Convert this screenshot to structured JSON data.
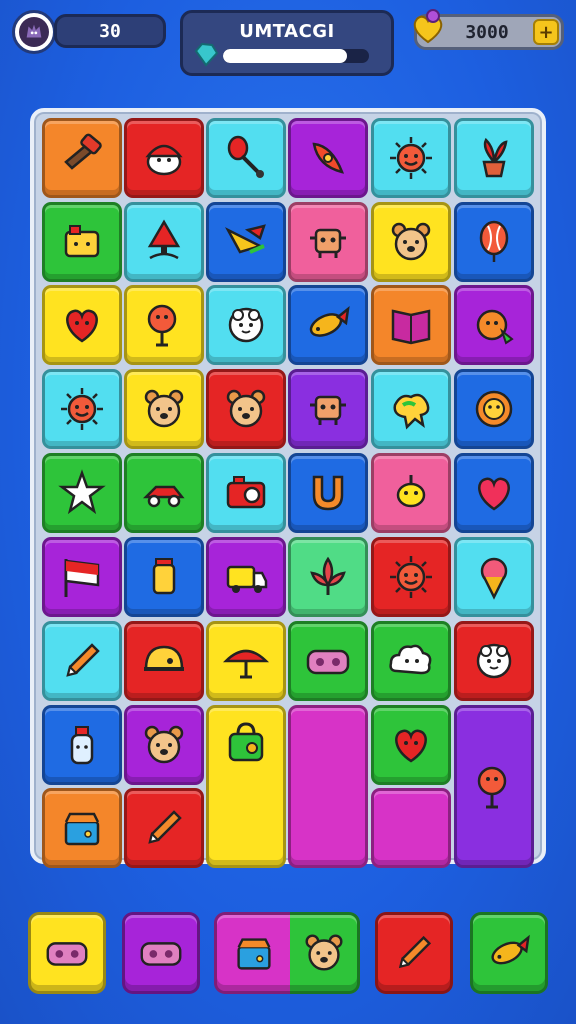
{
  "hud": {
    "moves": "30",
    "level_title": "UMTACGI",
    "level_progress_fraction": 0.85,
    "coins": "3000",
    "coins_plus": "+"
  },
  "colors": {
    "background": "#1d5fe0",
    "orange": "#f4862a",
    "red": "#e52525",
    "cyan": "#52def0",
    "purple": "#a724d9",
    "blue": "#1f6be3",
    "green": "#2ec43a",
    "yellow": "#ffe320",
    "pink": "#f0609c",
    "magenta": "#d733c7",
    "violet": "#8a2fe0",
    "mint": "#50dc86"
  },
  "board": {
    "tiles": [
      {
        "color": "orange",
        "icon": "hammer-icon"
      },
      {
        "color": "red",
        "icon": "santa-icon"
      },
      {
        "color": "cyan",
        "icon": "whisk-icon"
      },
      {
        "color": "purple",
        "icon": "rocket-icon"
      },
      {
        "color": "cyan",
        "icon": "sun-face-icon"
      },
      {
        "color": "cyan",
        "icon": "flower-pot-icon"
      },
      {
        "color": "green",
        "icon": "toy-box-icon"
      },
      {
        "color": "cyan",
        "icon": "tree-icon"
      },
      {
        "color": "blue",
        "icon": "bird-icon"
      },
      {
        "color": "pink",
        "icon": "robot-icon"
      },
      {
        "color": "yellow",
        "icon": "bear-face-icon"
      },
      {
        "color": "blue",
        "icon": "balloon-icon"
      },
      {
        "color": "yellow",
        "icon": "heart-face-icon"
      },
      {
        "color": "yellow",
        "icon": "lollipop-icon"
      },
      {
        "color": "cyan",
        "icon": "sheep-icon"
      },
      {
        "color": "blue",
        "icon": "fish-icon"
      },
      {
        "color": "orange",
        "icon": "book-icon"
      },
      {
        "color": "purple",
        "icon": "orange-fruit-icon"
      },
      {
        "color": "cyan",
        "icon": "sun-face-icon"
      },
      {
        "color": "yellow",
        "icon": "bear-face-icon"
      },
      {
        "color": "red",
        "icon": "bear-face-icon"
      },
      {
        "color": "violet",
        "icon": "robot-icon"
      },
      {
        "color": "cyan",
        "icon": "paint-splat-icon"
      },
      {
        "color": "blue",
        "icon": "lion-face-icon"
      },
      {
        "color": "green",
        "icon": "star-icon"
      },
      {
        "color": "green",
        "icon": "toy-car-icon"
      },
      {
        "color": "cyan",
        "icon": "camera-icon"
      },
      {
        "color": "blue",
        "icon": "magnet-icon"
      },
      {
        "color": "pink",
        "icon": "lemon-icon"
      },
      {
        "color": "blue",
        "icon": "heart-icon"
      },
      {
        "color": "purple",
        "icon": "flag-icon"
      },
      {
        "color": "blue",
        "icon": "jar-icon"
      },
      {
        "color": "purple",
        "icon": "truck-icon"
      },
      {
        "color": "mint",
        "icon": "lotus-icon"
      },
      {
        "color": "red",
        "icon": "sun-face-icon"
      },
      {
        "color": "cyan",
        "icon": "ice-cream-icon"
      },
      {
        "color": "cyan",
        "icon": "pencil-icon"
      },
      {
        "color": "red",
        "icon": "helmet-icon"
      },
      {
        "color": "yellow",
        "icon": "umbrella-icon"
      },
      {
        "color": "green",
        "icon": "gamepad-icon"
      },
      {
        "color": "green",
        "icon": "cloud-face-icon"
      },
      {
        "color": "red",
        "icon": "sheep-icon"
      },
      {
        "color": "blue",
        "icon": "bottle-icon"
      },
      {
        "color": "purple",
        "icon": "bear-face-icon"
      },
      {
        "color": "yellow",
        "icon": "bag-icon"
      },
      {
        "color": "magenta",
        "icon": ""
      },
      {
        "color": "green",
        "icon": "heart-face-icon"
      },
      {
        "color": "violet",
        "icon": "lollipop-icon"
      },
      {
        "color": "orange",
        "icon": "basket-icon"
      },
      {
        "color": "red",
        "icon": "pencil-icon"
      }
    ]
  },
  "tray": {
    "slots": [
      {
        "color": "yellow",
        "icon": "gamepad-icon"
      },
      {
        "color": "purple",
        "icon": "gamepad-icon"
      },
      {
        "color": "magenta",
        "icon": "basket-icon"
      },
      {
        "color": "green",
        "icon": "bear-face-icon"
      },
      {
        "color": "red",
        "icon": "pencil-icon"
      },
      {
        "color": "green",
        "icon": "fish-icon"
      }
    ]
  }
}
